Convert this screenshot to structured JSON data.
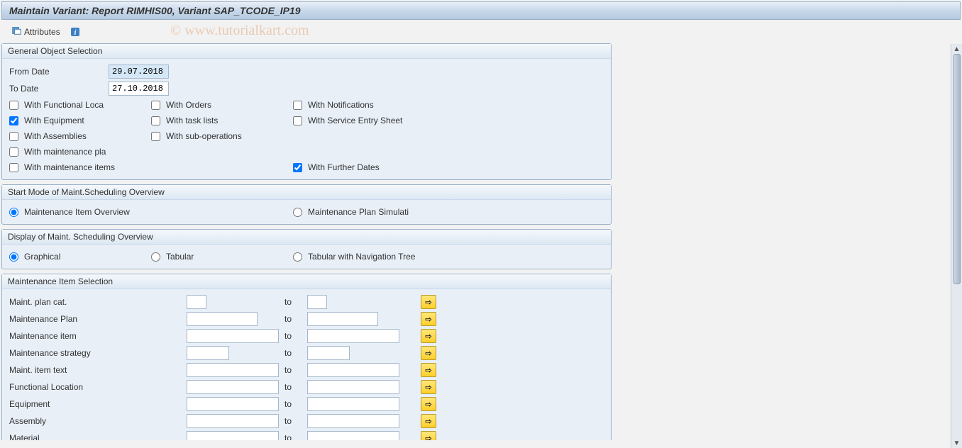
{
  "title": "Maintain Variant: Report RIMHIS00, Variant SAP_TCODE_IP19",
  "toolbar": {
    "attributes_label": "Attributes"
  },
  "watermark": "© www.tutorialkart.com",
  "groups": {
    "general": {
      "title": "General Object Selection",
      "from_date_label": "From Date",
      "from_date_value": "29.07.2018",
      "to_date_label": "To Date",
      "to_date_value": "27.10.2018",
      "checkboxes": {
        "func_loc": "With Functional Loca",
        "orders": "With Orders",
        "notifications": "With Notifications",
        "equipment": "With Equipment",
        "task_lists": "With task lists",
        "service_entry": "With Service Entry Sheet",
        "assemblies": "With Assemblies",
        "sub_ops": "With sub-operations",
        "maint_pla": "With maintenance pla",
        "maint_items": "With maintenance items",
        "further_dates": "With Further Dates"
      }
    },
    "start_mode": {
      "title": "Start Mode of Maint.Scheduling Overview",
      "item_overview": "Maintenance Item Overview",
      "plan_simulati": "Maintenance Plan Simulati"
    },
    "display": {
      "title": "Display of Maint. Scheduling Overview",
      "graphical": "Graphical",
      "tabular": "Tabular",
      "tabular_nav": "Tabular with Navigation Tree"
    },
    "item_sel": {
      "title": "Maintenance Item Selection",
      "to_label": "to",
      "rows": [
        {
          "label": "Maint. plan cat.",
          "from_w": 28,
          "to_w": 28
        },
        {
          "label": "Maintenance Plan",
          "from_w": 100,
          "to_w": 100
        },
        {
          "label": "Maintenance item",
          "from_w": 130,
          "to_w": 130
        },
        {
          "label": "Maintenance strategy",
          "from_w": 60,
          "to_w": 60
        },
        {
          "label": "Maint. item text",
          "from_w": 130,
          "to_w": 130
        },
        {
          "label": "Functional Location",
          "from_w": 130,
          "to_w": 130
        },
        {
          "label": "Equipment",
          "from_w": 130,
          "to_w": 130
        },
        {
          "label": "Assembly",
          "from_w": 130,
          "to_w": 130
        },
        {
          "label": "Material",
          "from_w": 130,
          "to_w": 130
        }
      ]
    }
  }
}
